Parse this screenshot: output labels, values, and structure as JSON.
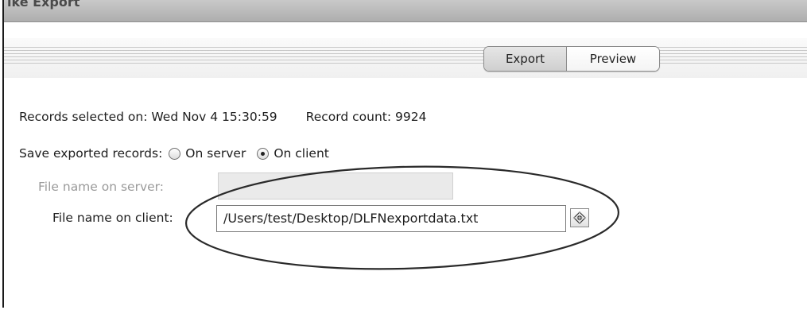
{
  "window": {
    "title": "ike Export"
  },
  "tabs": [
    {
      "label": "Export",
      "active": true
    },
    {
      "label": "Preview",
      "active": false
    }
  ],
  "records": {
    "selected_on_label": "Records selected on: Wed Nov  4 15:30:59",
    "count_label": "Record count: 9924"
  },
  "save": {
    "label": "Save exported records:",
    "options": [
      {
        "label": "On server",
        "selected": false
      },
      {
        "label": "On client",
        "selected": true
      }
    ]
  },
  "server_file": {
    "label": "File name on server:",
    "value": "",
    "enabled": false
  },
  "client_file": {
    "label": "File name on client:",
    "value": "/Users/test/Desktop/DLFNexportdata.txt",
    "enabled": true
  },
  "browse_button": {
    "icon": "browse-diamond-icon"
  },
  "colors": {
    "titlebar": "#b8b8b8",
    "disabled_text": "#9a9a9a",
    "annotation": "#2a2a2a"
  }
}
